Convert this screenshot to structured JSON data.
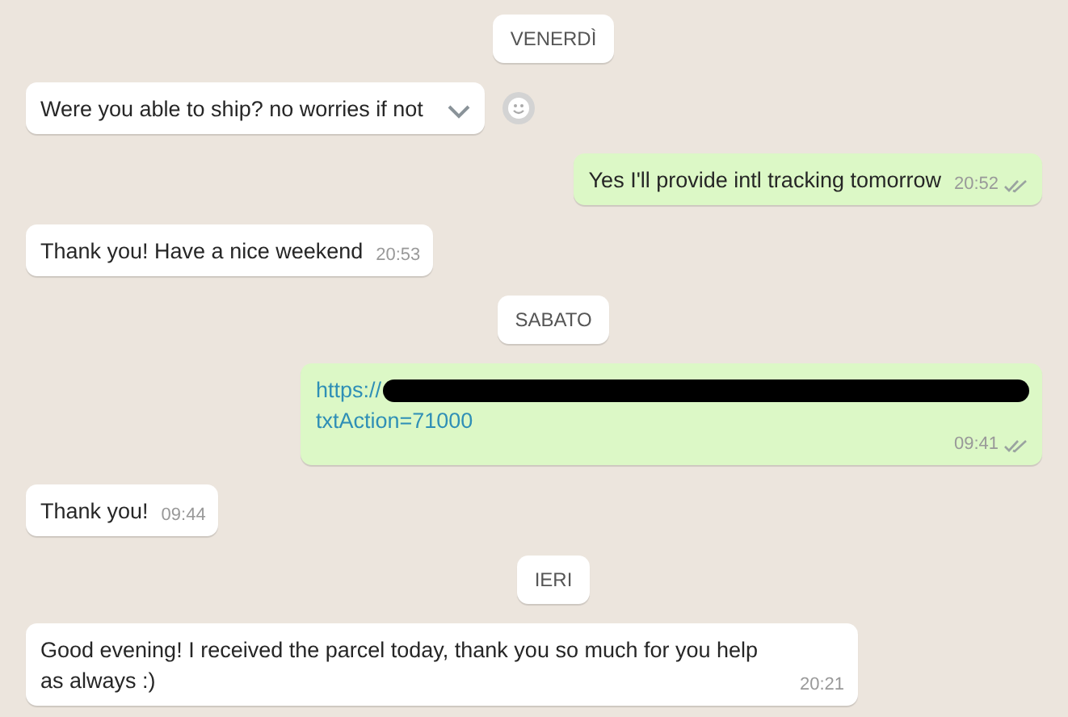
{
  "messages": [
    {
      "kind": "date",
      "text": "VENERDÌ"
    },
    {
      "kind": "in",
      "text": "Were you able to ship? no worries if not",
      "hovered": true
    },
    {
      "kind": "out",
      "text": "Yes I'll provide intl tracking tomorrow",
      "time": "20:52",
      "read": false
    },
    {
      "kind": "in",
      "text": "Thank you! Have a nice weekend",
      "time": "20:53"
    },
    {
      "kind": "date",
      "text": "SABATO"
    },
    {
      "kind": "link",
      "lines": [
        "https://",
        "txtAction=71000"
      ],
      "redacted": true,
      "time": "09:41",
      "read": false
    },
    {
      "kind": "in",
      "text": "Thank you!",
      "time": "09:44"
    },
    {
      "kind": "date",
      "text": "IERI"
    },
    {
      "kind": "in",
      "text": "Good evening! I received the parcel today, thank you so much for you help as always :)",
      "time": "20:21"
    }
  ]
}
